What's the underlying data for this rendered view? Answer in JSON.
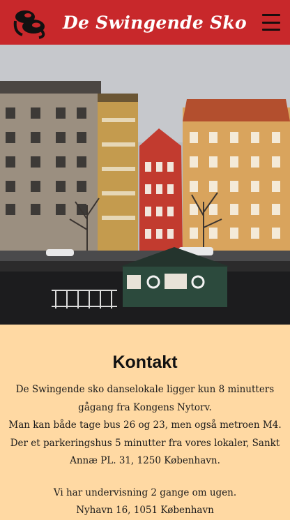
{
  "header": {
    "title": "De Swingende Sko",
    "logo_icon": "dance-shoes-logo-icon",
    "menu_icon": "hamburger-menu-icon",
    "brand_color": "#c8282b"
  },
  "hero": {
    "image_subject": "nyhavn-colourful-buildings-photo"
  },
  "contact": {
    "heading": "Kontakt",
    "paragraph1": [
      "De Swingende sko danselokale ligger kun 8 minutters",
      "gågang fra Kongens Nytorv.",
      "Man kan både tage bus 26 og 23, men også metroen M4.",
      "Der et parkeringshus 5 minutter fra vores lokaler, Sankt",
      "Annæ PL. 31, 1250 København."
    ],
    "paragraph2": [
      "Vi har undervisning 2 gange om ugen.",
      "Nyhavn 16, 1051 København"
    ],
    "background_color": "#ffd9a3"
  }
}
